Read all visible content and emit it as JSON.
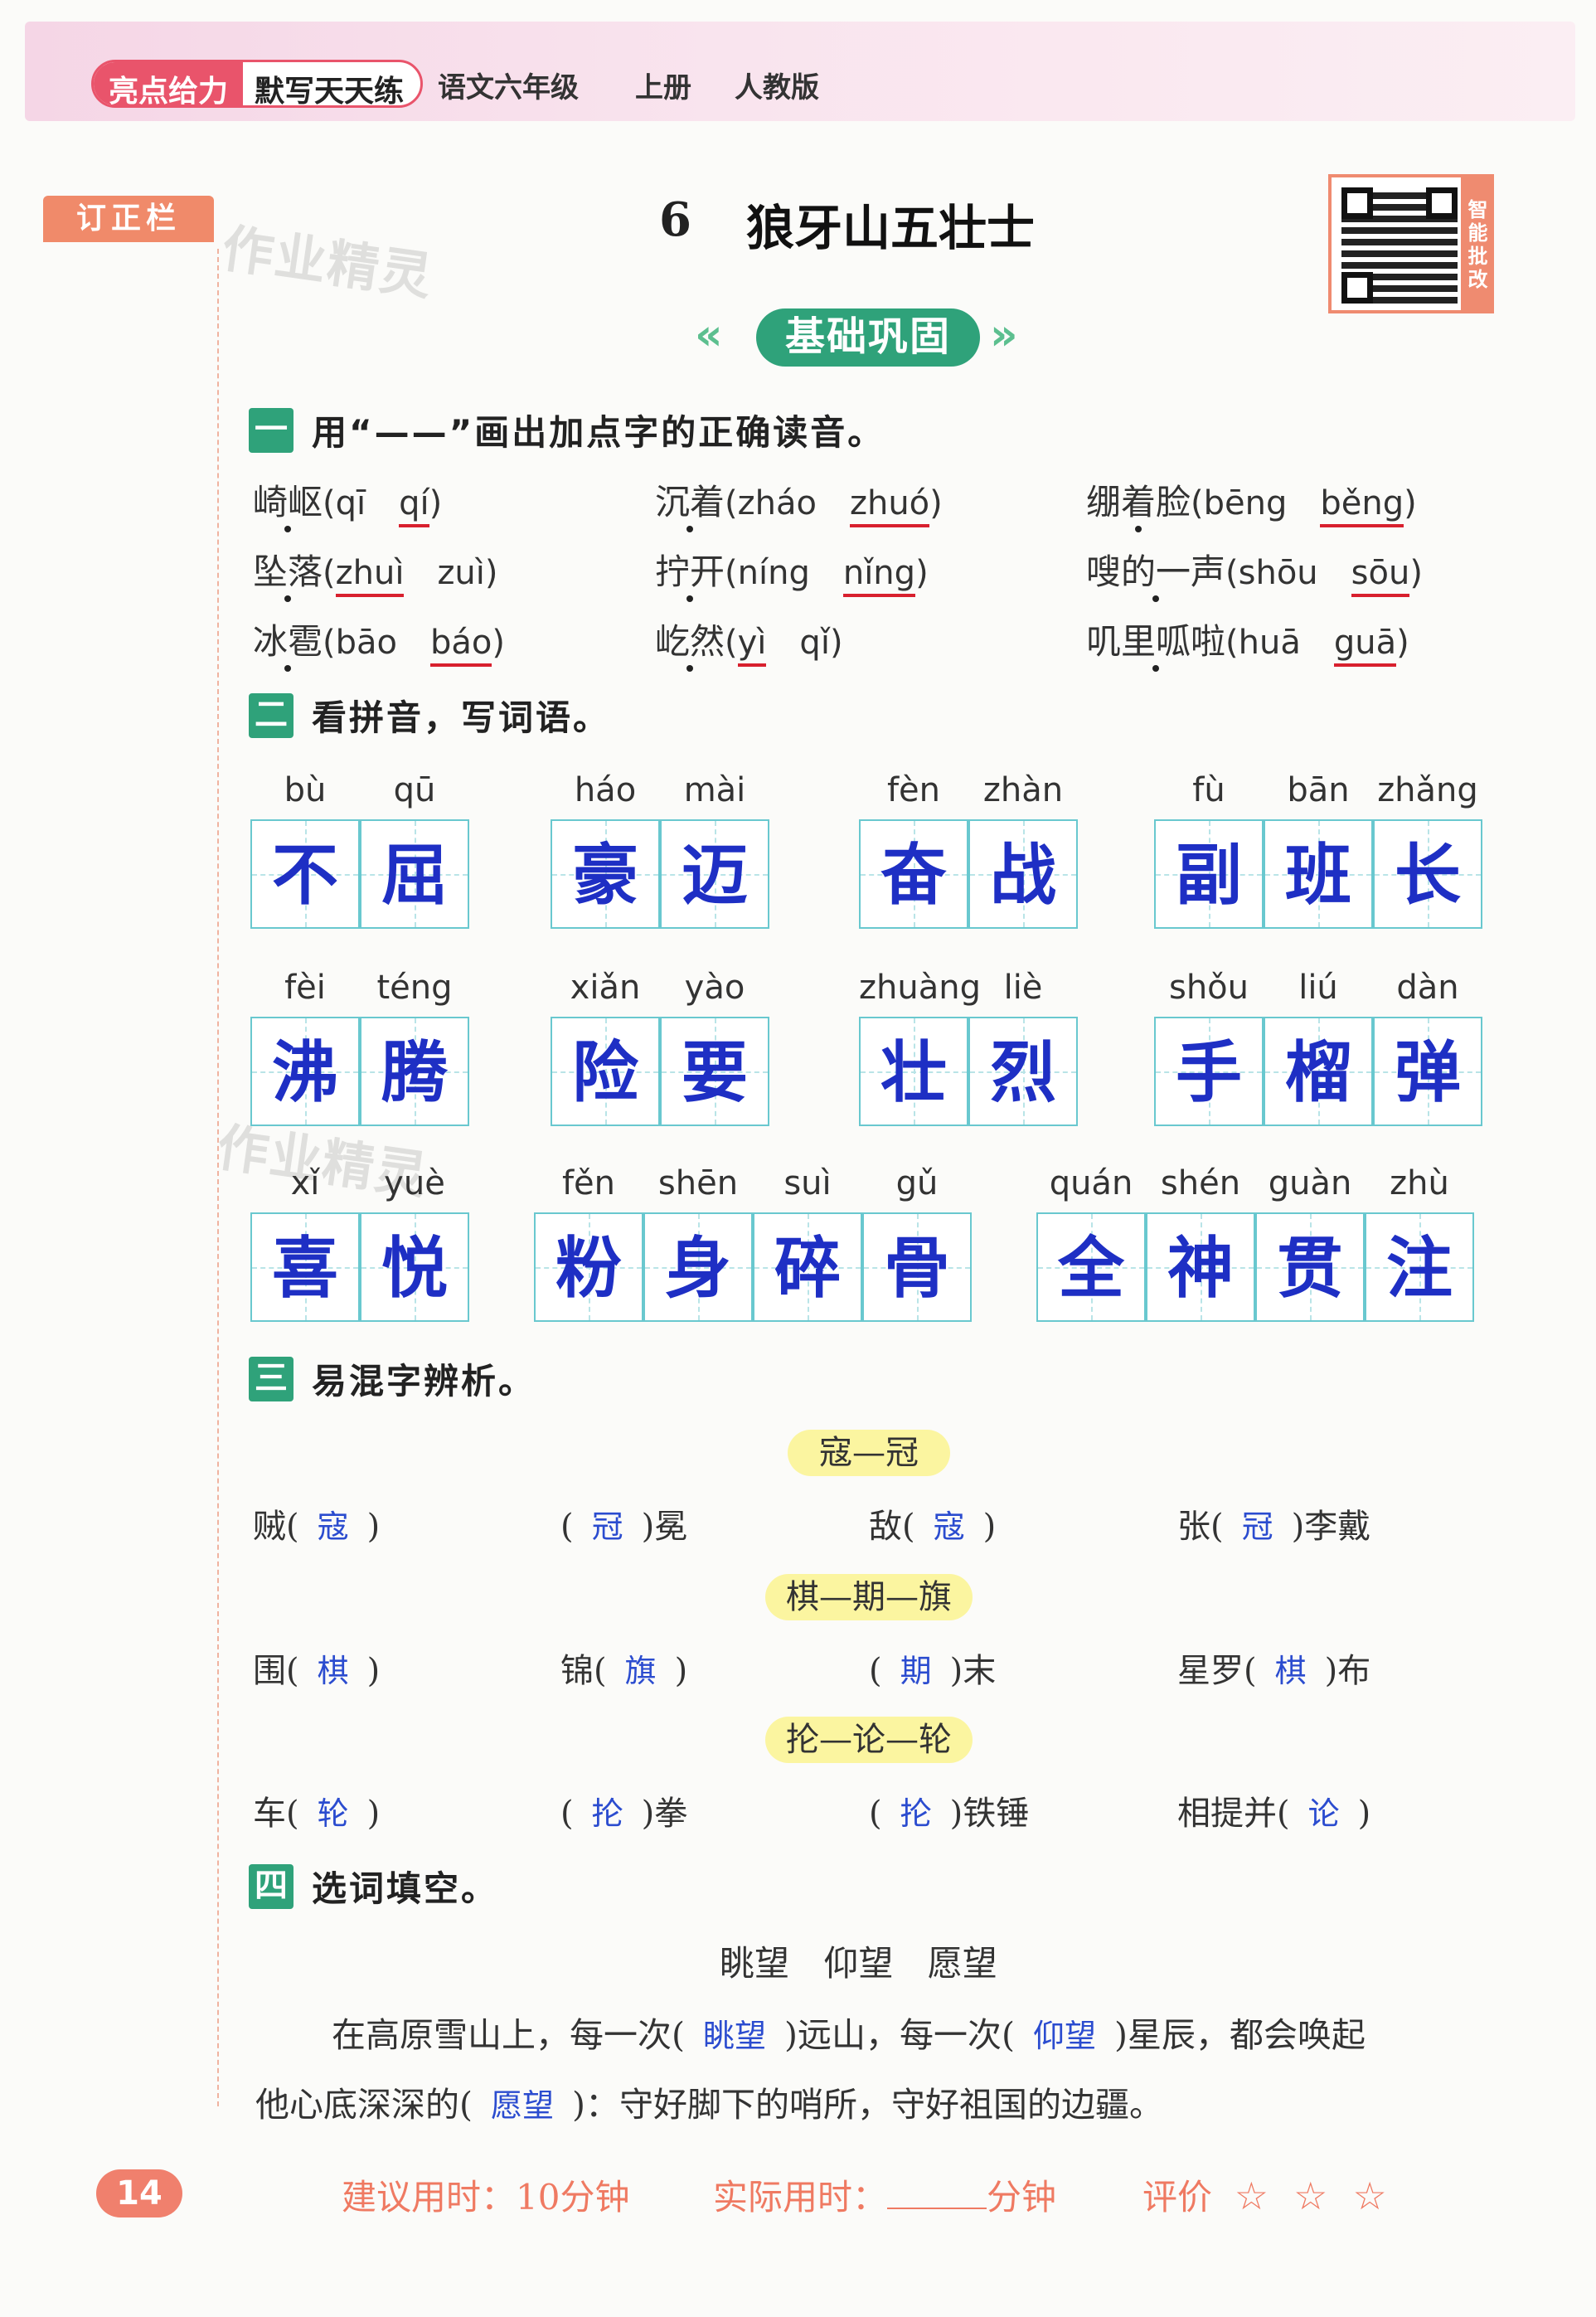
{
  "header": {
    "brand_a": "亮点给力",
    "brand_b": "默写天天练",
    "subject": "语文六年级",
    "volume": "上册",
    "edition": "人教版"
  },
  "sidebar": {
    "correction_label": "订正栏"
  },
  "watermark": "作业精灵",
  "lesson": {
    "number": "6",
    "title": "狼牙山五壮士"
  },
  "qr": {
    "side_label": "智能批改"
  },
  "section_banner": "基础巩固",
  "q1": {
    "badge": "一",
    "instruction": "用“——”画出加点字的正确读音。",
    "items": [
      {
        "word": "崎岖",
        "open": "(",
        "opt1": "qī",
        "opt2": "qí",
        "close": ")"
      },
      {
        "word": "沉着",
        "open": "(",
        "opt1": "zháo",
        "opt2": "zhuó",
        "close": ")"
      },
      {
        "word": "绷着脸",
        "open": "(",
        "opt1": "bēng",
        "opt2": "běng",
        "close": ")"
      },
      {
        "word": "坠落",
        "open": "(",
        "opt1": "zhuì",
        "opt2": "zuì",
        "close": ")"
      },
      {
        "word": "拧开",
        "open": "(",
        "opt1": "níng",
        "opt2": "nǐng",
        "close": ")"
      },
      {
        "word": "嗖的一声",
        "open": "(",
        "opt1": "shōu",
        "opt2": "sōu",
        "close": ")"
      },
      {
        "word": "冰雹",
        "open": "(",
        "opt1": "bāo",
        "opt2": "báo",
        "close": ")"
      },
      {
        "word": "屹然",
        "open": "(",
        "opt1": "yì",
        "opt2": "qǐ",
        "close": ")"
      },
      {
        "word": "叽里呱啦",
        "open": "(",
        "opt1": "huā",
        "opt2": "guā",
        "close": ")"
      }
    ]
  },
  "q2": {
    "badge": "二",
    "instruction": "看拼音，写词语。",
    "words": [
      {
        "pinyin": [
          "bù",
          "qū"
        ],
        "chars": [
          "不",
          "屈"
        ]
      },
      {
        "pinyin": [
          "háo",
          "mài"
        ],
        "chars": [
          "豪",
          "迈"
        ]
      },
      {
        "pinyin": [
          "fèn",
          "zhàn"
        ],
        "chars": [
          "奋",
          "战"
        ]
      },
      {
        "pinyin": [
          "fù",
          "bān",
          "zhǎng"
        ],
        "chars": [
          "副",
          "班",
          "长"
        ]
      },
      {
        "pinyin": [
          "fèi",
          "téng"
        ],
        "chars": [
          "沸",
          "腾"
        ]
      },
      {
        "pinyin": [
          "xiǎn",
          "yào"
        ],
        "chars": [
          "险",
          "要"
        ]
      },
      {
        "pinyin": [
          "zhuàng",
          "liè"
        ],
        "chars": [
          "壮",
          "烈"
        ]
      },
      {
        "pinyin": [
          "shǒu",
          "liú",
          "dàn"
        ],
        "chars": [
          "手",
          "榴",
          "弹"
        ]
      },
      {
        "pinyin": [
          "xǐ",
          "yuè"
        ],
        "chars": [
          "喜",
          "悦"
        ]
      },
      {
        "pinyin": [
          "fěn",
          "shēn",
          "suì",
          "gǔ"
        ],
        "chars": [
          "粉",
          "身",
          "碎",
          "骨"
        ]
      },
      {
        "pinyin": [
          "quán",
          "shén",
          "guàn",
          "zhù"
        ],
        "chars": [
          "全",
          "神",
          "贯",
          "注"
        ]
      }
    ]
  },
  "q3": {
    "badge": "三",
    "instruction": "易混字辨析。",
    "groups": [
      {
        "tag": "寇—冠",
        "items": [
          {
            "pre": "贼(",
            "ans": "寇",
            "post": ")"
          },
          {
            "pre": "(",
            "ans": "冠",
            "post": ")冕"
          },
          {
            "pre": "敌(",
            "ans": "寇",
            "post": ")"
          },
          {
            "pre": "张(",
            "ans": "冠",
            "post": ")李戴"
          }
        ]
      },
      {
        "tag": "棋—期—旗",
        "items": [
          {
            "pre": "围(",
            "ans": "棋",
            "post": ")"
          },
          {
            "pre": "锦(",
            "ans": "旗",
            "post": ")"
          },
          {
            "pre": "(",
            "ans": "期",
            "post": ")末"
          },
          {
            "pre": "星罗(",
            "ans": "棋",
            "post": ")布"
          }
        ]
      },
      {
        "tag": "抡—论—轮",
        "items": [
          {
            "pre": "车(",
            "ans": "轮",
            "post": ")"
          },
          {
            "pre": "(",
            "ans": "抡",
            "post": ")拳"
          },
          {
            "pre": "(",
            "ans": "抡",
            "post": ")铁锤"
          },
          {
            "pre": "相提并(",
            "ans": "论",
            "post": ")"
          }
        ]
      }
    ]
  },
  "q4": {
    "badge": "四",
    "instruction": "选词填空。",
    "choices": "眺望 仰望 愿望",
    "line1_a": "在高原雪山上，每一次(",
    "line1_ans1": "眺望",
    "line1_b": ")远山，每一次(",
    "line1_ans2": "仰望",
    "line1_c": ")星辰，都会唤起",
    "line2_a": "他心底深深的(",
    "line2_ans": "愿望",
    "line2_b": ")：守好脚下的哨所，守好祖国的边疆。"
  },
  "footer": {
    "page_number": "14",
    "suggested_label": "建议用时：10分钟",
    "actual_label": "实际用时：",
    "actual_unit": "分钟",
    "rating_label": "评价",
    "star_glyph": "☆"
  }
}
